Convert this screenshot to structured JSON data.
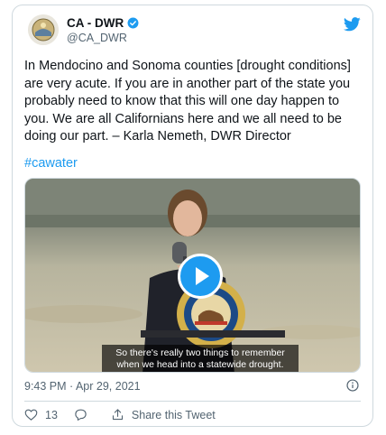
{
  "account": {
    "name": "CA - DWR",
    "handle": "@CA_DWR"
  },
  "tweet": {
    "text": "In Mendocino and Sonoma counties [drought conditions] are very acute. If you are in another part of the state you probably need to know that this will one day happen to you. We are all Californians here and we all need to be doing our part. – Karla Nemeth, DWR Director",
    "hashtag": "#cawater",
    "timestamp": "9:43 PM · Apr 29, 2021"
  },
  "video": {
    "caption_line1": "So there's really two things to remember",
    "caption_line2": "when we head into a statewide drought."
  },
  "actions": {
    "likes": "13",
    "share_label": "Share this Tweet"
  },
  "colors": {
    "accent": "#1d9bf0",
    "text": "#0f1419",
    "muted": "#536471"
  },
  "icons": [
    "verified-badge-icon",
    "twitter-bird-icon",
    "play-icon",
    "info-icon",
    "heart-icon",
    "reply-icon",
    "share-icon"
  ]
}
